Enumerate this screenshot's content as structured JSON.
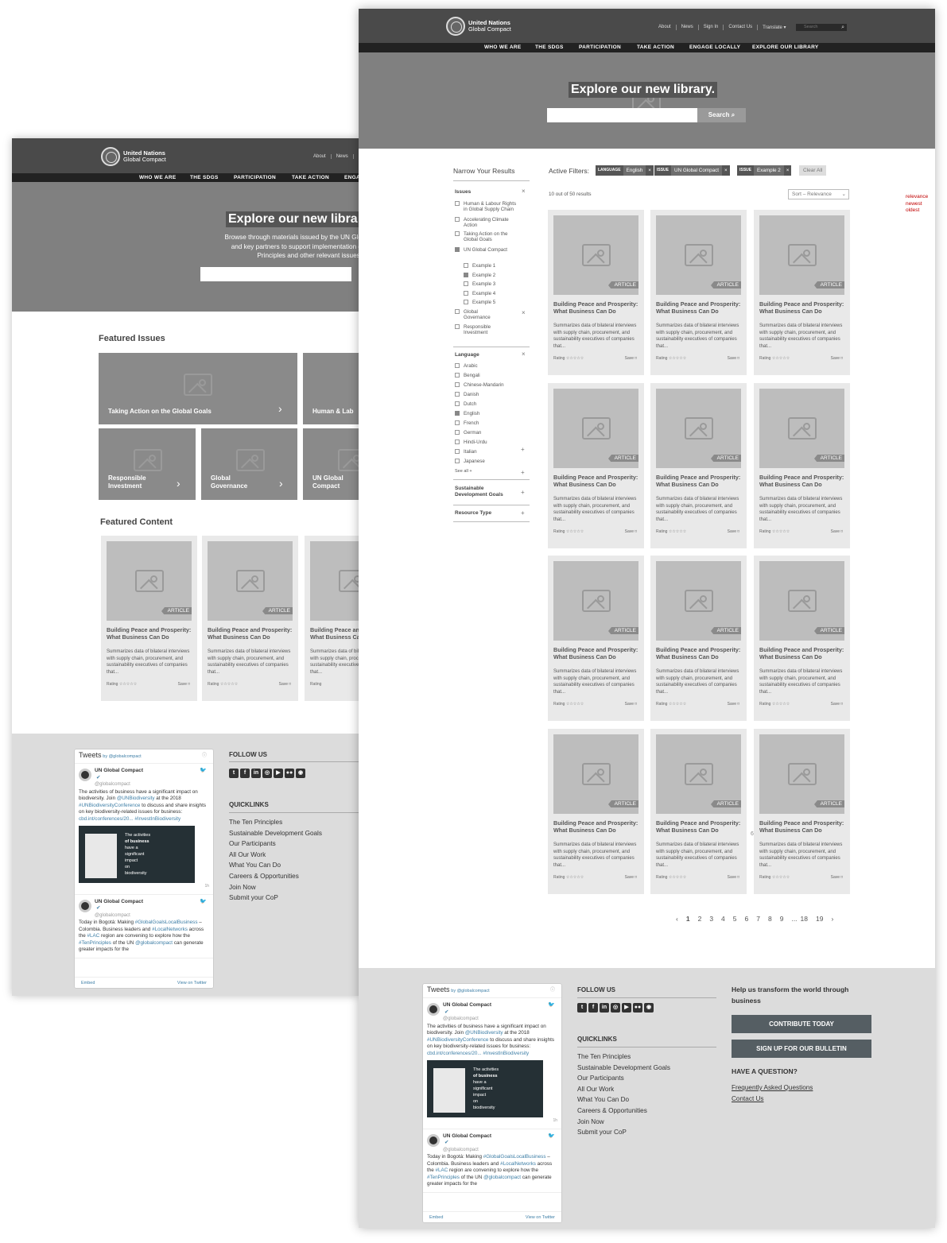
{
  "header": {
    "logo_line1": "United Nations",
    "logo_line2": "Global Compact",
    "topnav": [
      "About",
      "News",
      "Sign In",
      "Contact Us"
    ],
    "translate": "Translate",
    "search_placeholder": "Search",
    "mainnav": [
      "WHO WE ARE",
      "THE SDGS",
      "PARTICIPATION",
      "TAKE ACTION",
      "ENGAGE LOCALLY",
      "EXPLORE OUR LIBRARY"
    ]
  },
  "back": {
    "topnav": [
      "About",
      "News"
    ],
    "mainnav": [
      "WHO WE ARE",
      "THE SDGS",
      "PARTICIPATION",
      "TAKE ACTION",
      "ENGA"
    ],
    "hero_title": "Explore our new libra",
    "hero_text": [
      "Browse through materials issued by the UN Glo",
      "and key partners to support implementation o",
      "Principles and other relevant issues."
    ],
    "featured_issues_title": "Featured Issues",
    "issues": [
      "Taking Action on the Global Goals",
      "Human & Lab",
      "Responsible Investment",
      "Global Governance",
      "UN Global Compact"
    ],
    "featured_content_title": "Featured Content",
    "cards": [
      {
        "tag": "ARTICLE",
        "title": "Building Peace and Prosperity: What Business Can Do",
        "desc": "Summarizes data of bilateral interviews with supply chain, procurement, and sustainability executives of companies that...",
        "rating": "Rating ☆☆☆☆☆",
        "save": "Save ⌑"
      },
      {
        "tag": "ARTICLE",
        "title": "Building Peace and Prosperity: What Business Can Do",
        "desc": "Summarizes data of bilateral interviews with supply chain, procurement, and sustainability executives of companies that...",
        "rating": "Rating ☆☆☆☆☆",
        "save": "Save ⌑"
      },
      {
        "tag": "ARTICLE",
        "title": "Building Peace and Prosperity: What Business Can Do",
        "desc": "Summarizes data of bilateral interviews with supply chain, procurement, and sustainability executives of companies that...",
        "rating": "Rating",
        "save": ""
      }
    ]
  },
  "front": {
    "hero_title": "Explore our new library.",
    "search_button": "Search",
    "narrow_title": "Narrow Your Results",
    "issues_label": "Issues",
    "issues": [
      {
        "label": "Human & Labour Rights in Global Supply Chain",
        "checked": false
      },
      {
        "label": "Accelerating Climate Action",
        "checked": false
      },
      {
        "label": "Taking Action on the Global Goals",
        "checked": false
      },
      {
        "label": "UN Global Compact",
        "checked": true
      }
    ],
    "sub_issues": [
      {
        "label": "Example 1",
        "checked": false
      },
      {
        "label": "Example 2",
        "checked": true
      },
      {
        "label": "Example 3",
        "checked": false
      },
      {
        "label": "Example 4",
        "checked": false
      },
      {
        "label": "Example 5",
        "checked": false
      }
    ],
    "issues_more": [
      {
        "label": "Global Governance",
        "checked": false
      },
      {
        "label": "Responsible Investment",
        "checked": false
      }
    ],
    "language_label": "Language",
    "languages": [
      {
        "label": "Arabic",
        "checked": false
      },
      {
        "label": "Bengali",
        "checked": false
      },
      {
        "label": "Chinese-Mandarin",
        "checked": false
      },
      {
        "label": "Danish",
        "checked": false
      },
      {
        "label": "Dutch",
        "checked": false
      },
      {
        "label": "English",
        "checked": true
      },
      {
        "label": "French",
        "checked": false
      },
      {
        "label": "German",
        "checked": false
      },
      {
        "label": "Hindi-Urdu",
        "checked": false
      },
      {
        "label": "Italian",
        "checked": false
      },
      {
        "label": "Japanese",
        "checked": false
      }
    ],
    "see_all": "See all +",
    "sdg_label": "Sustainable Development Goals",
    "resource_label": "Resource Type",
    "active_filters_label": "Active Filters:",
    "filters": [
      {
        "key": "LANGUAGE",
        "value": "English"
      },
      {
        "key": "ISSUE",
        "value": "UN Global Compact"
      },
      {
        "key": "ISSUE",
        "value": "Example 2"
      }
    ],
    "clear_all": "Clear All",
    "results_count": "10 out of 50 results",
    "sort_label": "Sort – Relevance",
    "sort_options": [
      "relevance",
      "newest",
      "oldest"
    ],
    "card": {
      "tag": "ARTICLE",
      "title": "Building Peace and Prosperity: What Business Can Do",
      "desc": "Summarizes data of bilateral interviews with supply chain, procurement, and sustainability executives of companies that...",
      "rating": "Rating ☆☆☆☆☆",
      "save": "Save ⌑"
    },
    "stray_mark": "6",
    "pager": {
      "prev": "‹",
      "pages": [
        "1",
        "2",
        "3",
        "4",
        "5",
        "6",
        "7",
        "8",
        "9",
        "...",
        "18",
        "19"
      ],
      "next": "›"
    }
  },
  "footer": {
    "tweets_title": "Tweets",
    "tweets_by": "by @globalcompact",
    "tweet1_name": "UN Global Compact",
    "tweet1_handle": "@globalcompact",
    "tweet1_text_a": "The activities of business have a significant impact on biodiversity. Join",
    "tweet1_link1": "@UNBiodiversity",
    "tweet1_text_b": "at the 2018",
    "tweet1_link2": "#UNBiodiversityConference",
    "tweet1_text_c": "to discuss and share insights on key biodiversity-related issues for business:",
    "tweet1_link3": "cbd.int/conferences/20...",
    "tweet1_link4": "#InvestInBiodiversity",
    "tweet_img_text": [
      "The activities",
      "of business",
      "have a",
      "significant",
      "impact",
      "on",
      "biodiversity"
    ],
    "tweet_time": "1h",
    "tweet2_name": "UN Global Compact",
    "tweet2_handle": "@globalcompact",
    "tweet2_text_a": "Today in Bogotá: Making",
    "tweet2_link1": "#GlobalGoalsLocalBusiness",
    "tweet2_text_b": "– Colombia. Business leaders and",
    "tweet2_link2": "#LocalNetworks",
    "tweet2_text_c": "across the",
    "tweet2_link3": "#LAC",
    "tweet2_text_d": "region are convening to explore how the",
    "tweet2_link4": "#TenPrinciples",
    "tweet2_text_e": "of the UN",
    "tweet2_link5": "@globalcompact",
    "tweet2_text_f": "can generate greater impacts for the",
    "embed": "Embed",
    "view_on_twitter": "View on Twitter",
    "follow_us": "FOLLOW US",
    "social": [
      "t",
      "f",
      "in",
      "◎",
      "▶",
      "●●",
      "◉"
    ],
    "quicklinks_title": "QUICKLINKS",
    "quicklinks": [
      "The Ten Principles",
      "Sustainable Development Goals",
      "Our Participants",
      "All Our Work",
      "What You Can Do",
      "Careers & Opportunities",
      "Join Now",
      "Submit your CoP"
    ],
    "help_title": "Help us transform the world through business",
    "contribute": "CONTRIBUTE TODAY",
    "signup": "SIGN UP FOR OUR BULLETIN",
    "question": "HAVE A QUESTION?",
    "faq": "Frequently Asked Questions",
    "contact": "Contact Us"
  },
  "colors": {
    "header": "#4a4a4a",
    "navbar": "#222222",
    "hero": "#808080",
    "footer": "#dcdcdc",
    "sort_options": "#c00000",
    "footer_button": "#555e63"
  }
}
